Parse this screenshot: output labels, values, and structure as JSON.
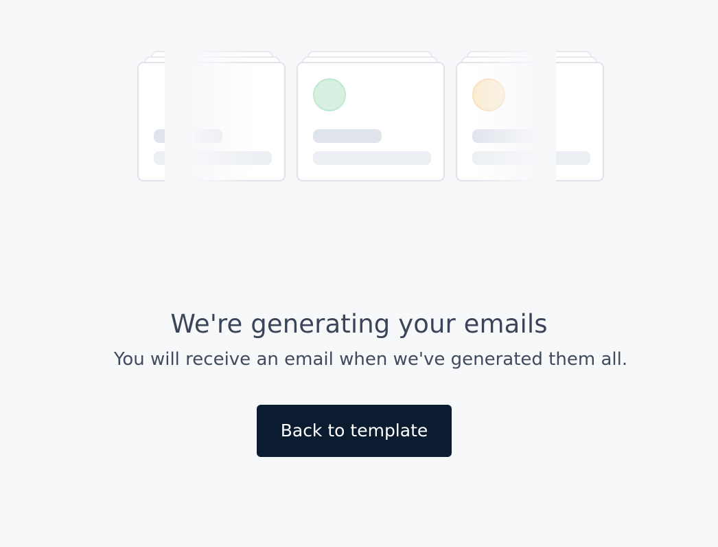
{
  "illustration": {
    "cards": [
      {
        "avatar_color": "#ffffff",
        "avatar_border": "#ffffff"
      },
      {
        "avatar_color": "#d5f0e1",
        "avatar_border": "#bfe8cf"
      },
      {
        "avatar_color": "#fbecd2",
        "avatar_border": "#f6e1bc"
      }
    ]
  },
  "status": {
    "headline": "We're generating your emails",
    "subline": "You will receive an email when we've generated them all."
  },
  "actions": {
    "back_label": "Back to template"
  },
  "colors": {
    "background": "#f7f8fa",
    "button_bg": "#0b1c31",
    "button_text": "#ffffff",
    "text": "#3b4558"
  }
}
